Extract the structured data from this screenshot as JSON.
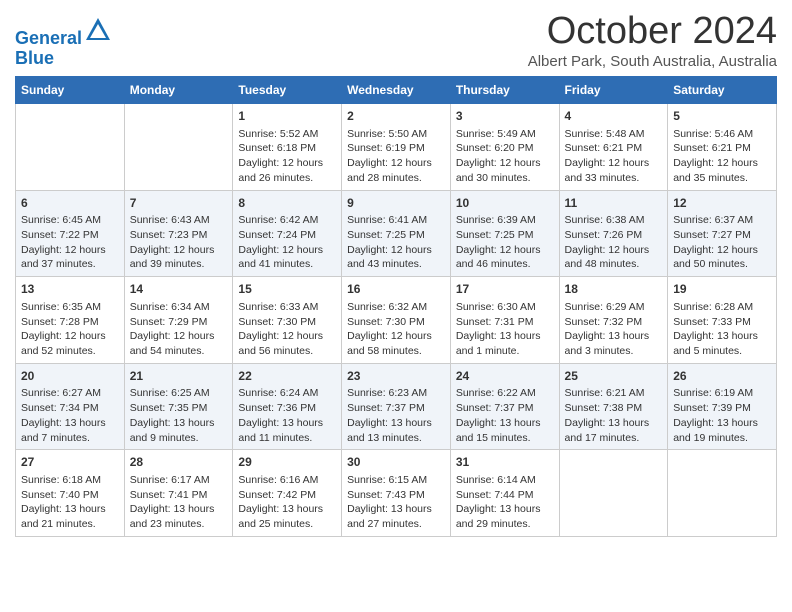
{
  "logo": {
    "line1": "General",
    "line2": "Blue"
  },
  "title": "October 2024",
  "location": "Albert Park, South Australia, Australia",
  "days_of_week": [
    "Sunday",
    "Monday",
    "Tuesday",
    "Wednesday",
    "Thursday",
    "Friday",
    "Saturday"
  ],
  "weeks": [
    [
      {
        "day": "",
        "info": ""
      },
      {
        "day": "",
        "info": ""
      },
      {
        "day": "1",
        "info": "Sunrise: 5:52 AM\nSunset: 6:18 PM\nDaylight: 12 hours\nand 26 minutes."
      },
      {
        "day": "2",
        "info": "Sunrise: 5:50 AM\nSunset: 6:19 PM\nDaylight: 12 hours\nand 28 minutes."
      },
      {
        "day": "3",
        "info": "Sunrise: 5:49 AM\nSunset: 6:20 PM\nDaylight: 12 hours\nand 30 minutes."
      },
      {
        "day": "4",
        "info": "Sunrise: 5:48 AM\nSunset: 6:21 PM\nDaylight: 12 hours\nand 33 minutes."
      },
      {
        "day": "5",
        "info": "Sunrise: 5:46 AM\nSunset: 6:21 PM\nDaylight: 12 hours\nand 35 minutes."
      }
    ],
    [
      {
        "day": "6",
        "info": "Sunrise: 6:45 AM\nSunset: 7:22 PM\nDaylight: 12 hours\nand 37 minutes."
      },
      {
        "day": "7",
        "info": "Sunrise: 6:43 AM\nSunset: 7:23 PM\nDaylight: 12 hours\nand 39 minutes."
      },
      {
        "day": "8",
        "info": "Sunrise: 6:42 AM\nSunset: 7:24 PM\nDaylight: 12 hours\nand 41 minutes."
      },
      {
        "day": "9",
        "info": "Sunrise: 6:41 AM\nSunset: 7:25 PM\nDaylight: 12 hours\nand 43 minutes."
      },
      {
        "day": "10",
        "info": "Sunrise: 6:39 AM\nSunset: 7:25 PM\nDaylight: 12 hours\nand 46 minutes."
      },
      {
        "day": "11",
        "info": "Sunrise: 6:38 AM\nSunset: 7:26 PM\nDaylight: 12 hours\nand 48 minutes."
      },
      {
        "day": "12",
        "info": "Sunrise: 6:37 AM\nSunset: 7:27 PM\nDaylight: 12 hours\nand 50 minutes."
      }
    ],
    [
      {
        "day": "13",
        "info": "Sunrise: 6:35 AM\nSunset: 7:28 PM\nDaylight: 12 hours\nand 52 minutes."
      },
      {
        "day": "14",
        "info": "Sunrise: 6:34 AM\nSunset: 7:29 PM\nDaylight: 12 hours\nand 54 minutes."
      },
      {
        "day": "15",
        "info": "Sunrise: 6:33 AM\nSunset: 7:30 PM\nDaylight: 12 hours\nand 56 minutes."
      },
      {
        "day": "16",
        "info": "Sunrise: 6:32 AM\nSunset: 7:30 PM\nDaylight: 12 hours\nand 58 minutes."
      },
      {
        "day": "17",
        "info": "Sunrise: 6:30 AM\nSunset: 7:31 PM\nDaylight: 13 hours\nand 1 minute."
      },
      {
        "day": "18",
        "info": "Sunrise: 6:29 AM\nSunset: 7:32 PM\nDaylight: 13 hours\nand 3 minutes."
      },
      {
        "day": "19",
        "info": "Sunrise: 6:28 AM\nSunset: 7:33 PM\nDaylight: 13 hours\nand 5 minutes."
      }
    ],
    [
      {
        "day": "20",
        "info": "Sunrise: 6:27 AM\nSunset: 7:34 PM\nDaylight: 13 hours\nand 7 minutes."
      },
      {
        "day": "21",
        "info": "Sunrise: 6:25 AM\nSunset: 7:35 PM\nDaylight: 13 hours\nand 9 minutes."
      },
      {
        "day": "22",
        "info": "Sunrise: 6:24 AM\nSunset: 7:36 PM\nDaylight: 13 hours\nand 11 minutes."
      },
      {
        "day": "23",
        "info": "Sunrise: 6:23 AM\nSunset: 7:37 PM\nDaylight: 13 hours\nand 13 minutes."
      },
      {
        "day": "24",
        "info": "Sunrise: 6:22 AM\nSunset: 7:37 PM\nDaylight: 13 hours\nand 15 minutes."
      },
      {
        "day": "25",
        "info": "Sunrise: 6:21 AM\nSunset: 7:38 PM\nDaylight: 13 hours\nand 17 minutes."
      },
      {
        "day": "26",
        "info": "Sunrise: 6:19 AM\nSunset: 7:39 PM\nDaylight: 13 hours\nand 19 minutes."
      }
    ],
    [
      {
        "day": "27",
        "info": "Sunrise: 6:18 AM\nSunset: 7:40 PM\nDaylight: 13 hours\nand 21 minutes."
      },
      {
        "day": "28",
        "info": "Sunrise: 6:17 AM\nSunset: 7:41 PM\nDaylight: 13 hours\nand 23 minutes."
      },
      {
        "day": "29",
        "info": "Sunrise: 6:16 AM\nSunset: 7:42 PM\nDaylight: 13 hours\nand 25 minutes."
      },
      {
        "day": "30",
        "info": "Sunrise: 6:15 AM\nSunset: 7:43 PM\nDaylight: 13 hours\nand 27 minutes."
      },
      {
        "day": "31",
        "info": "Sunrise: 6:14 AM\nSunset: 7:44 PM\nDaylight: 13 hours\nand 29 minutes."
      },
      {
        "day": "",
        "info": ""
      },
      {
        "day": "",
        "info": ""
      }
    ]
  ]
}
